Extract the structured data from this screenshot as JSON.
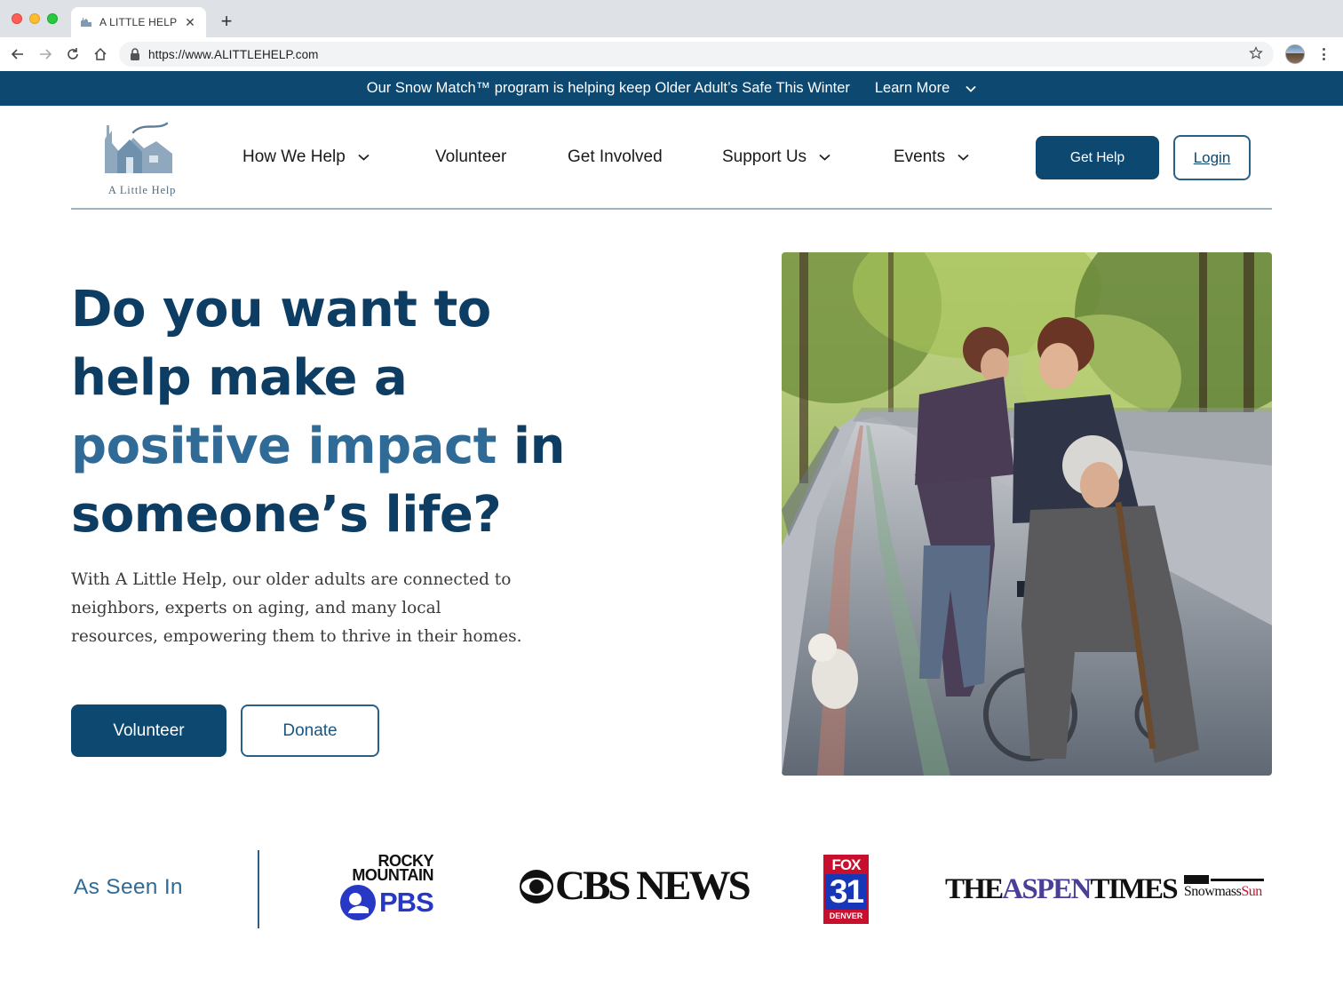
{
  "browser": {
    "tab_title": "A LITTLE HELP",
    "url": "https://www.ALITTLEHELP.com"
  },
  "announcement": {
    "text": "Our Snow Match™ program is helping keep Older Adult’s Safe This Winter",
    "link_label": "Learn More"
  },
  "header": {
    "logo_text": "A Little Help",
    "nav": [
      {
        "label": "How We Help",
        "has_dropdown": true
      },
      {
        "label": "Volunteer",
        "has_dropdown": false
      },
      {
        "label": "Get Involved",
        "has_dropdown": false
      },
      {
        "label": "Support Us",
        "has_dropdown": true
      },
      {
        "label": "Events",
        "has_dropdown": true
      }
    ],
    "get_help_label": "Get Help",
    "login_label": "Login"
  },
  "hero": {
    "title_line1": "Do you want to",
    "title_line2": "help make a",
    "title_line3_accent": "positive impact",
    "title_line3_rest": " in",
    "title_line4": "someone’s life?",
    "body": "With A Little Help, our older adults are connected to neighbors, experts on aging, and many local resources, empowering them to thrive in their homes.",
    "primary_button": "Volunteer",
    "secondary_button": "Donate"
  },
  "press": {
    "label": "As Seen In",
    "logos": {
      "pbs_top_line1": "ROCKY",
      "pbs_top_line2": "MOUNTAIN",
      "pbs_word": "PBS",
      "cbs_word": "CBS NEWS",
      "fox_top": "FOX",
      "fox_num": "31",
      "fox_bottom": "DENVER",
      "aspen_the": "THE",
      "aspen_mid": "ASPEN",
      "aspen_end": "TIMES",
      "snowmass": "Snowmass",
      "sun": "Sun"
    }
  },
  "colors": {
    "brand_navy": "#0d4870",
    "accent_blue": "#2f6b96",
    "divider": "#9fb2c0"
  }
}
